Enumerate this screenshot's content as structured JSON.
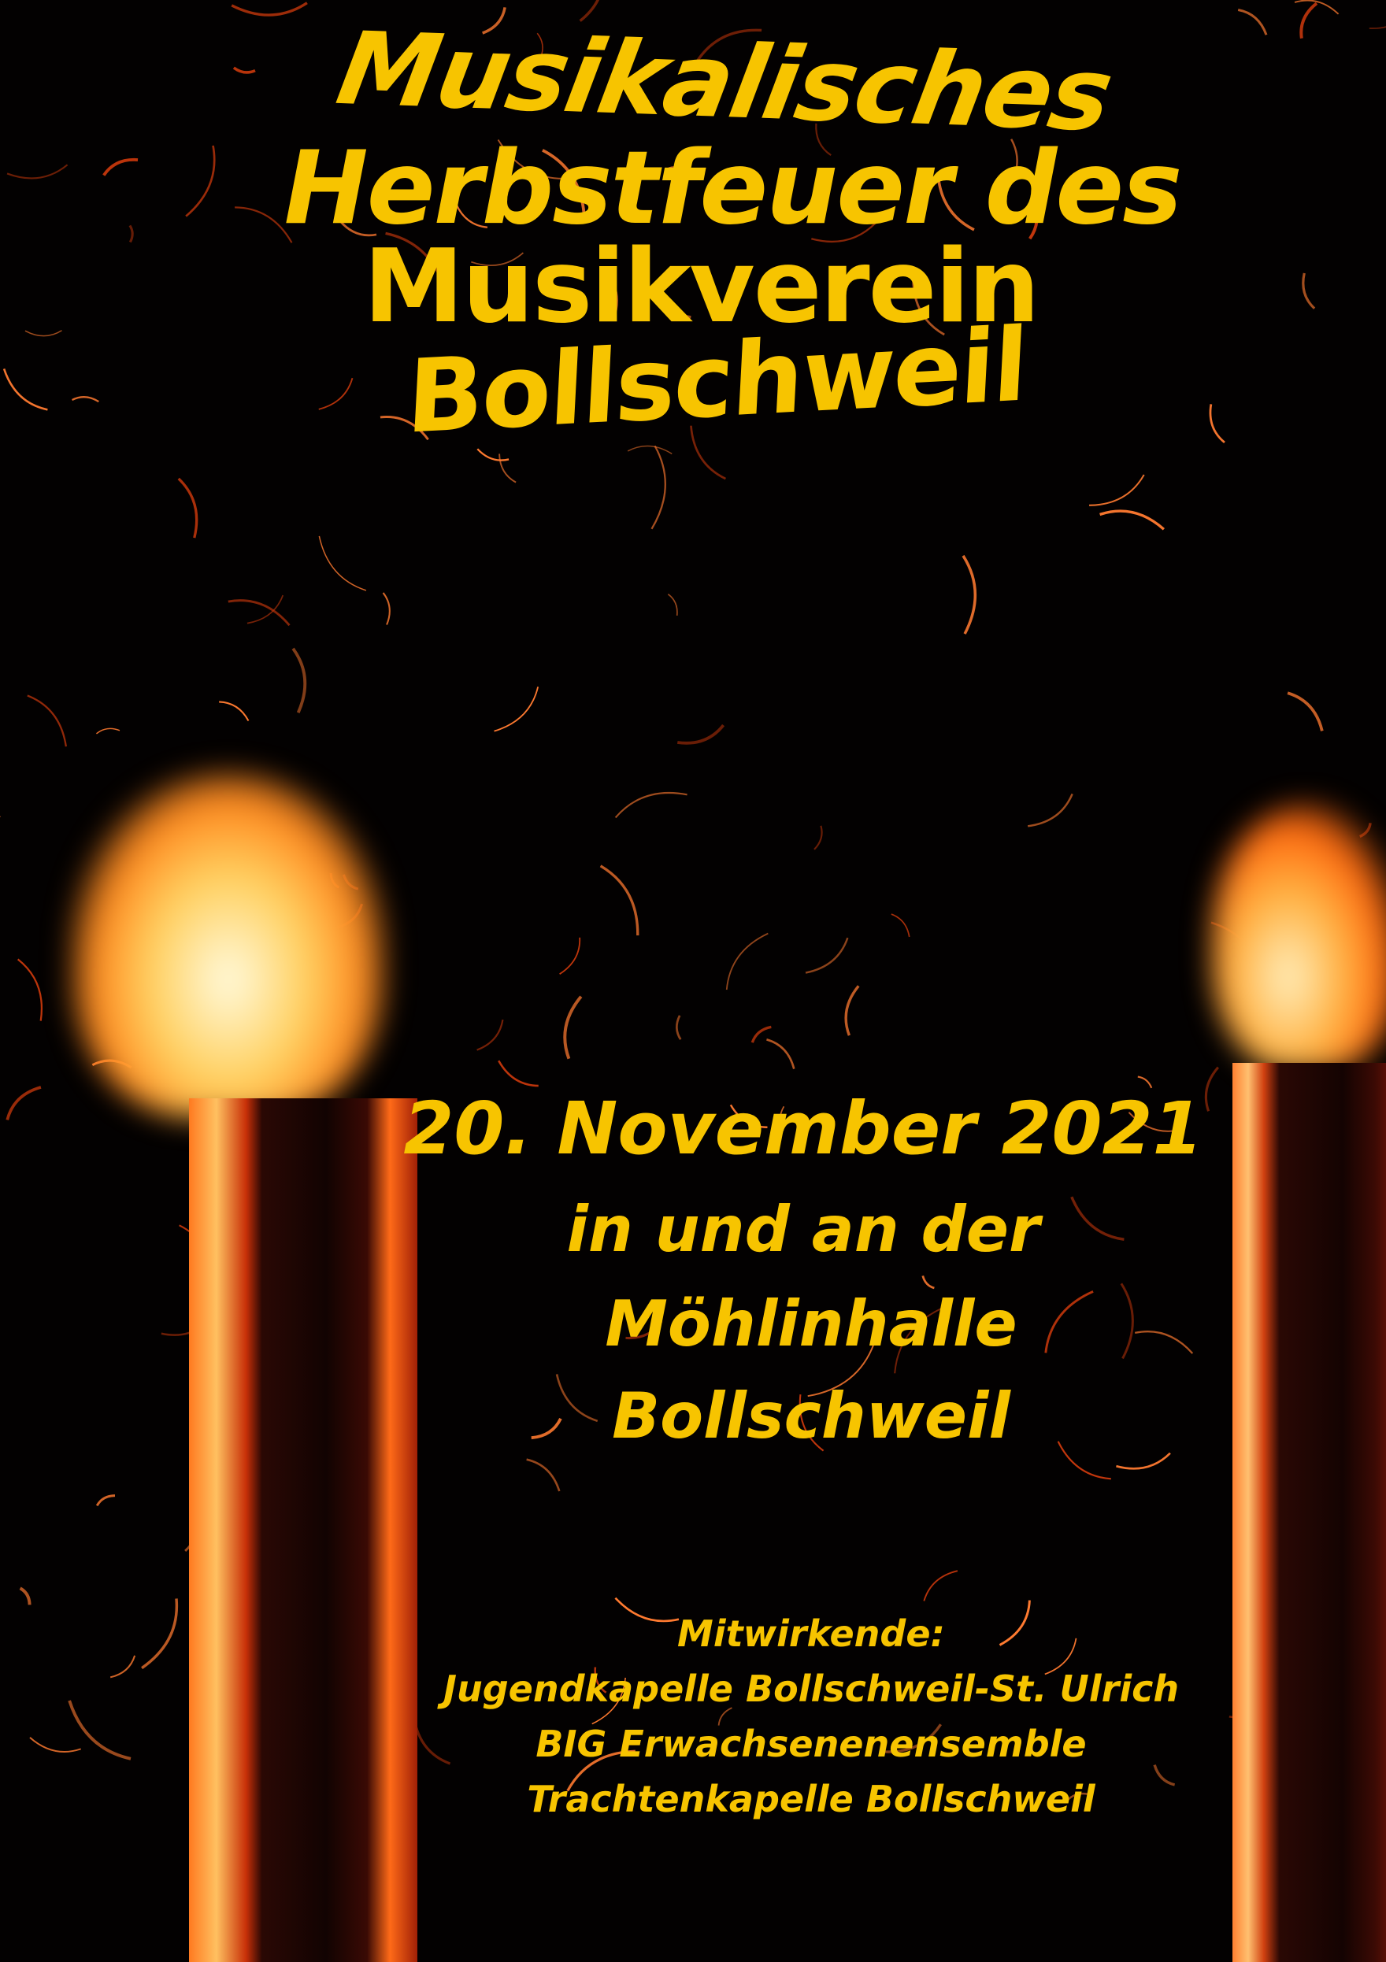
{
  "title": {
    "line1": "Musikalisches",
    "line2": "Herbstfeuer des",
    "line3": "Musikverein",
    "line4": "Bollschweil"
  },
  "event": {
    "date": "20. November 2021",
    "venue_line1": "in und an der",
    "venue_line2": "Möhlinhalle",
    "venue_line3": "Bollschweil"
  },
  "credits": {
    "heading": "Mitwirkende:",
    "performers": [
      "Jugendkapelle Bollschweil-St. Ulrich",
      "BIG Erwachsenenensemble",
      "Trachtenkapelle Bollschweil"
    ]
  },
  "colors": {
    "text": "#f7c400",
    "background": "#030101",
    "ember": "#ff5a10"
  },
  "background_image": "night photo of two burning wooden torches with flying sparks"
}
